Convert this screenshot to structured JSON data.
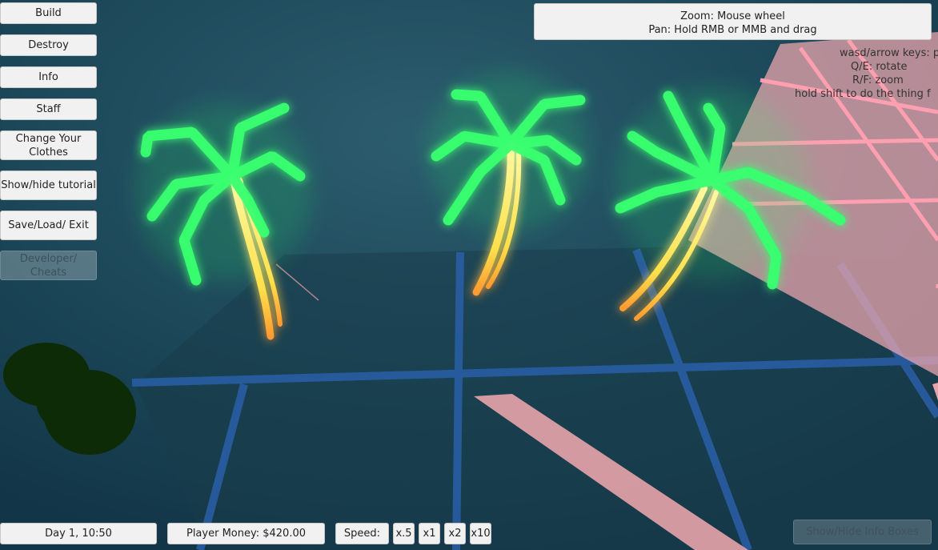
{
  "side_menu": {
    "build": "Build",
    "destroy": "Destroy",
    "info": "Info",
    "staff": "Staff",
    "clothes": "Change Your Clothes",
    "tutorial": "Show/hide tutorial",
    "save": "Save/Load/ Exit",
    "developer": "Developer/ Cheats"
  },
  "camera_help": {
    "zoom": "Zoom: Mouse wheel",
    "pan": "Pan: Hold RMB or MMB and drag"
  },
  "key_help": {
    "line1": "wasd/arrow keys: pa",
    "line2": "Q/E: rotate",
    "line3": "R/F: zoom",
    "line4": "hold shift to do the thing f"
  },
  "status_bar": {
    "day_time": "Day 1, 10:50",
    "money": "Player Money: $420.00",
    "speed_label": "Speed:",
    "speed_options": [
      "x.5",
      "x1",
      "x2",
      "x10"
    ]
  },
  "info_boxes_toggle": "Show/Hide Info Boxes",
  "colors": {
    "palm_leaves": "#33ff66",
    "palm_trunk": "#ffee66",
    "floor_grid": "#2a5fa8",
    "pink_grid": "#ffaab8"
  },
  "scene_objects": [
    "neon-palm-tree",
    "neon-palm-tree",
    "neon-palm-tree",
    "dark-shrub"
  ]
}
